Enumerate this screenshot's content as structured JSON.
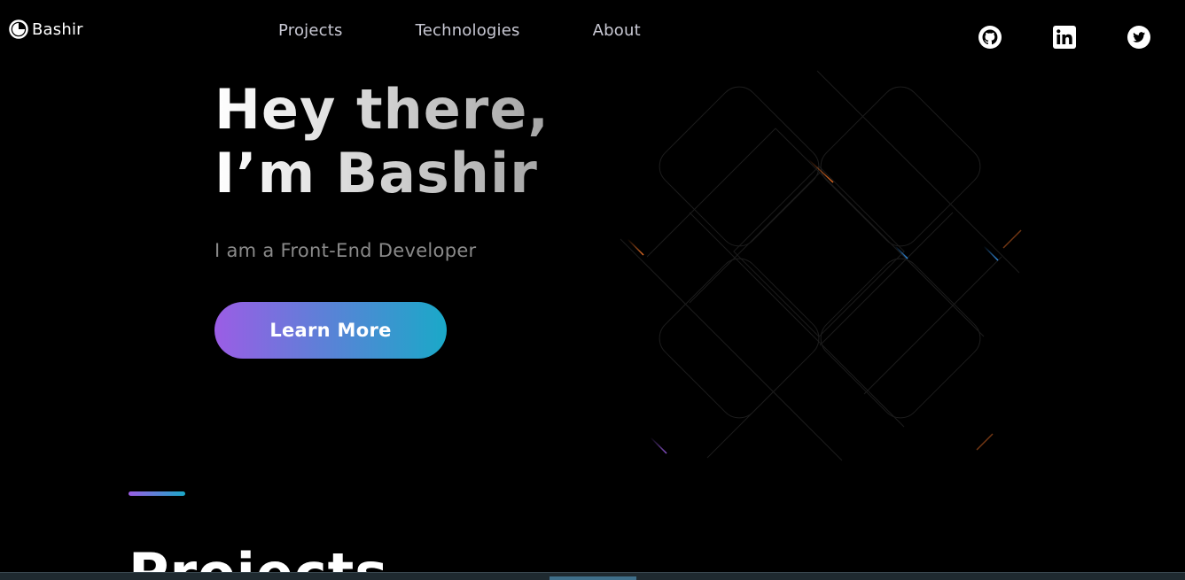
{
  "header": {
    "logo_text": "Bashir",
    "nav": [
      {
        "label": "Projects"
      },
      {
        "label": "Technologies"
      },
      {
        "label": "About"
      }
    ],
    "social": [
      {
        "icon": "github-icon"
      },
      {
        "icon": "linkedin-icon"
      },
      {
        "icon": "twitter-icon"
      }
    ]
  },
  "hero": {
    "title_line1": "Hey there,",
    "title_line2": "I’m Bashir",
    "subtitle": "I am a Front-End Developer",
    "cta_label": "Learn More"
  },
  "section": {
    "title": "Projects"
  },
  "colors": {
    "background": "#000000",
    "accent_start": "#9b5de5",
    "accent_end": "#1aa9c8",
    "nav_text": "#c9c9d4",
    "subtitle_text": "#8a8a8a"
  }
}
